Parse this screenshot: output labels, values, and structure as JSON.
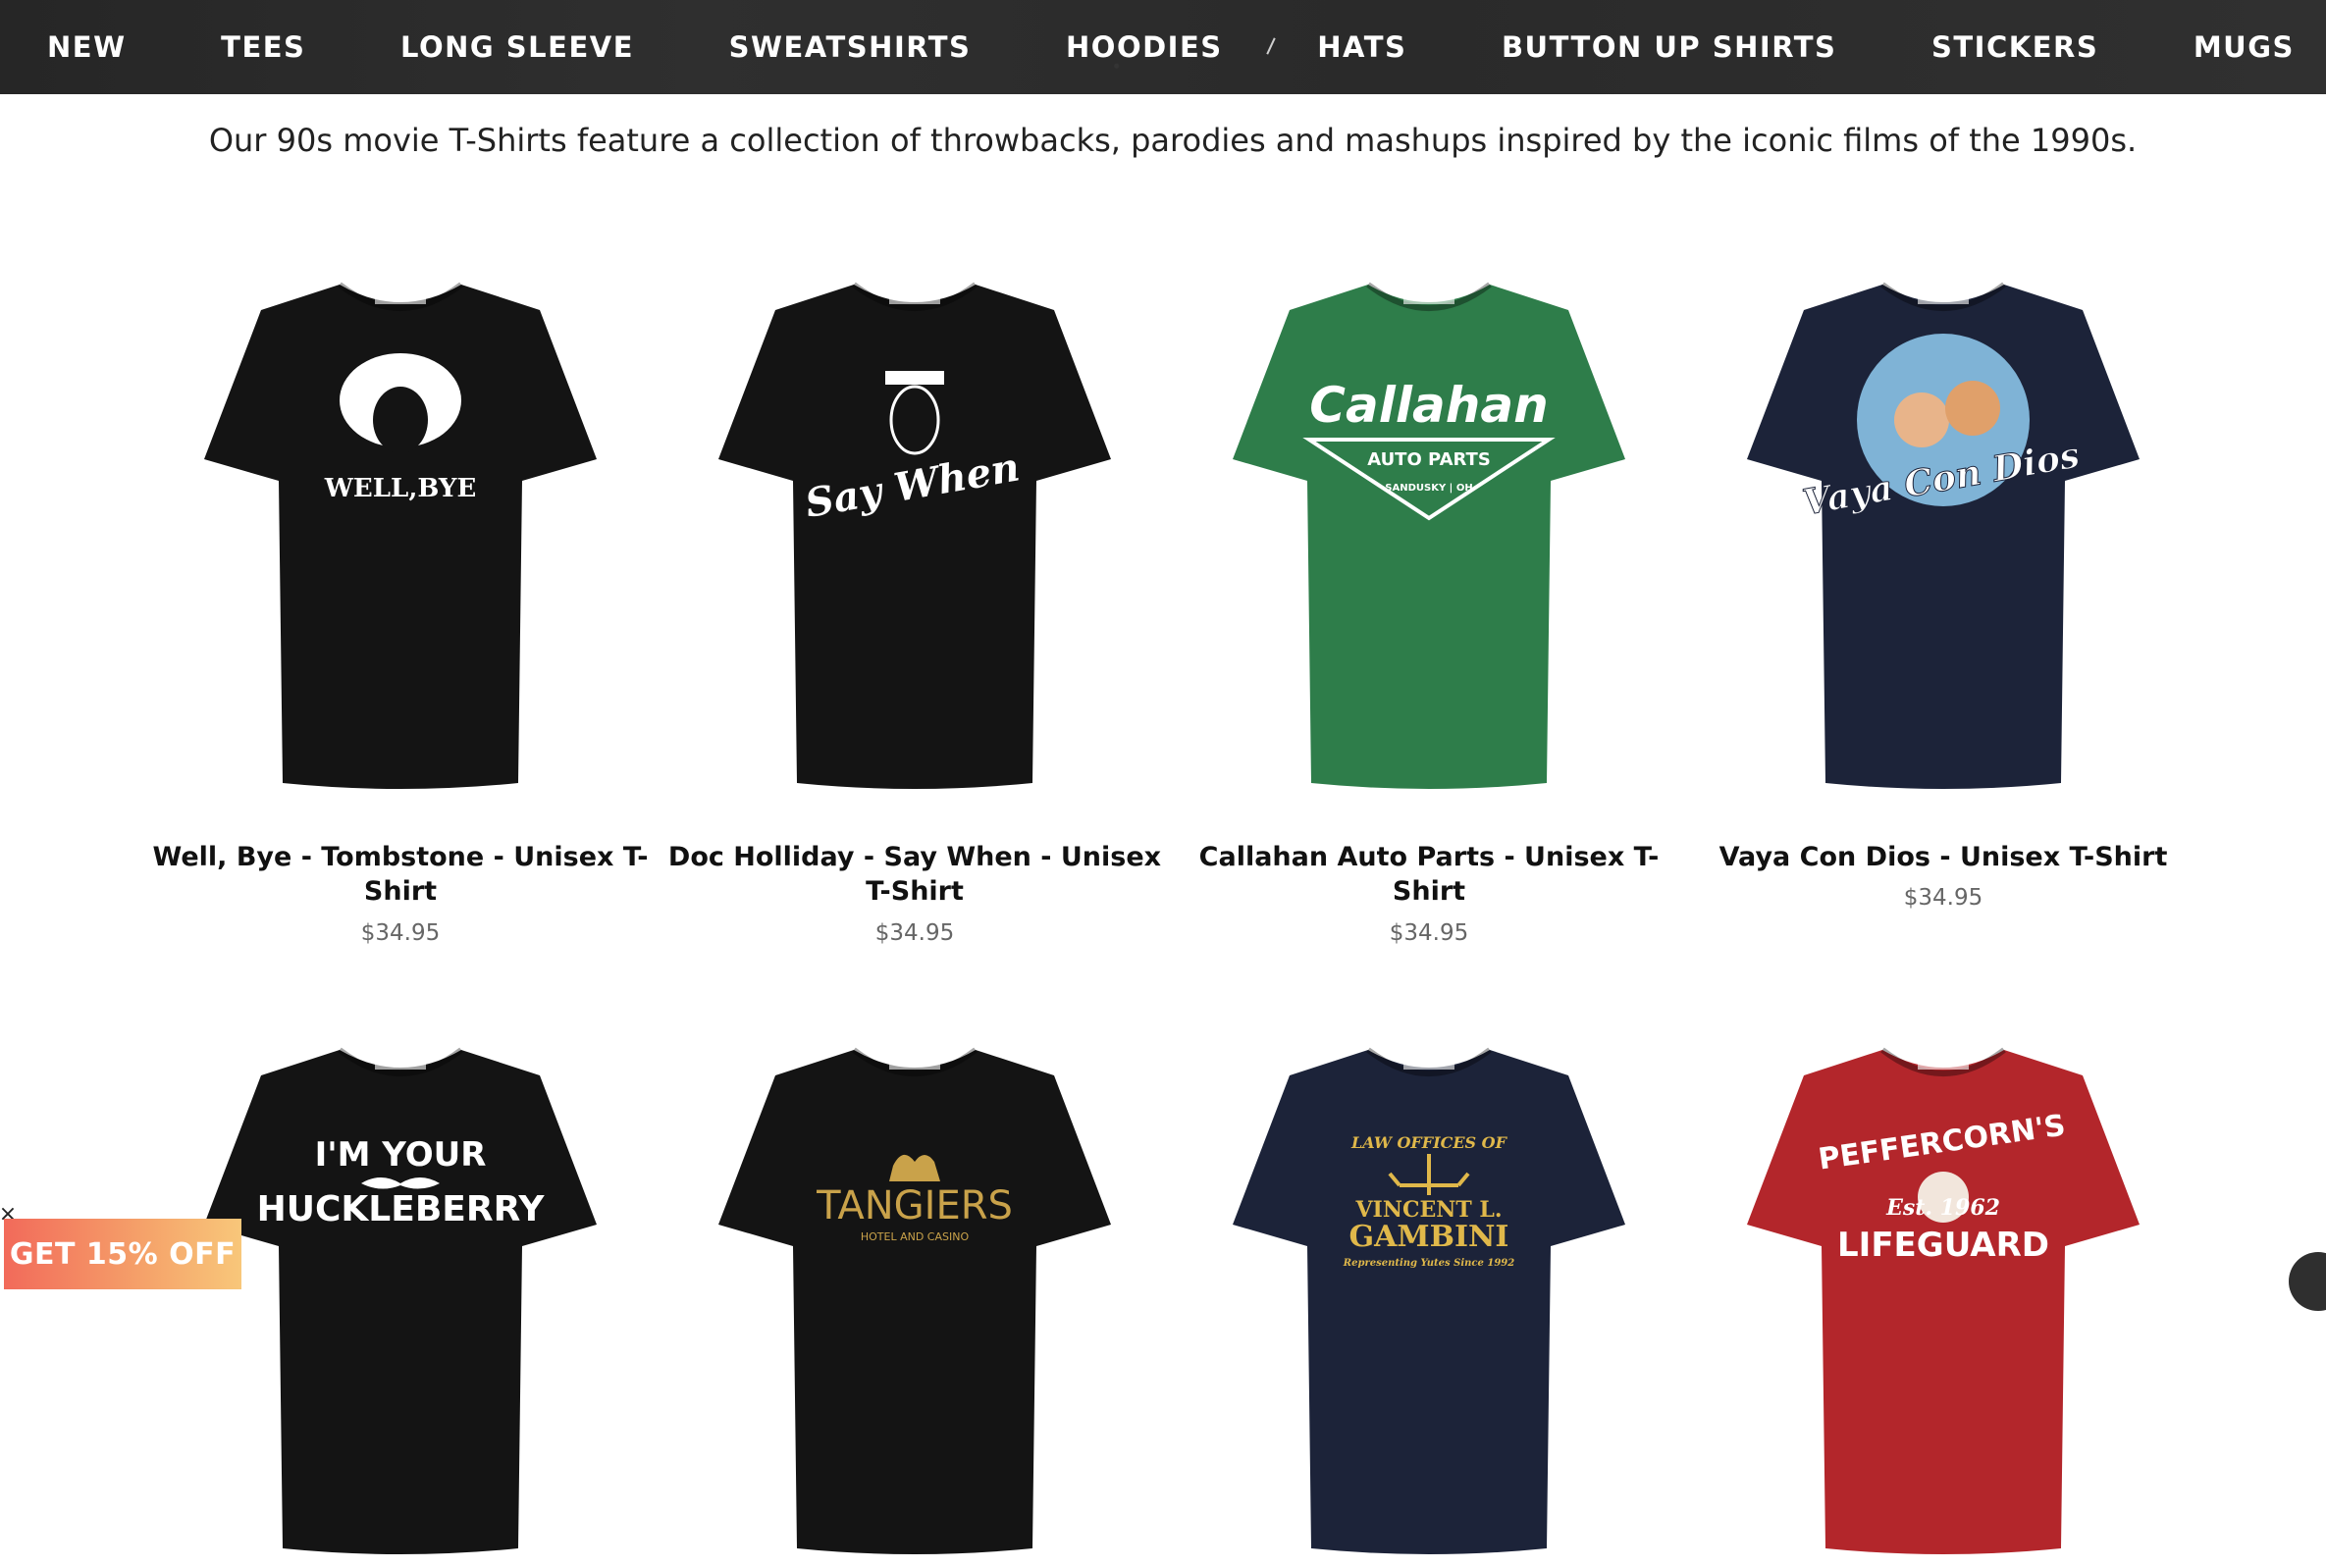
{
  "nav": {
    "items": [
      "NEW",
      "TEES",
      "LONG SLEEVE",
      "SWEATSHIRTS",
      "HOODIES",
      "HATS",
      "BUTTON UP SHIRTS",
      "STICKERS",
      "MUGS"
    ]
  },
  "intro": "Our 90s movie T-Shirts feature a collection of throwbacks, parodies and mashups inspired by the iconic films of the 1990s.",
  "products": [
    {
      "title": "Well, Bye - Tombstone - Unisex T-Shirt",
      "price": "$34.95",
      "shirt_color": "#141414",
      "print_text": "WELL,BYE",
      "print_color": "#ffffff"
    },
    {
      "title": "Doc Holliday - Say When - Unisex T-Shirt",
      "price": "$34.95",
      "shirt_color": "#141414",
      "print_text": "Say When",
      "print_color": "#ffffff"
    },
    {
      "title": "Callahan Auto Parts - Unisex T-Shirt",
      "price": "$34.95",
      "shirt_color": "#2e7d4a",
      "print_text": "Callahan",
      "print_sub": "AUTO PARTS",
      "print_sub2": "SANDUSKY | OH",
      "print_color": "#ffffff"
    },
    {
      "title": "Vaya Con Dios - Unisex T-Shirt",
      "price": "$34.95",
      "shirt_color": "#1c2339",
      "print_text": "Vaya Con Dios",
      "print_color": "#ffffff"
    },
    {
      "title": "",
      "price": "",
      "shirt_color": "#141414",
      "print_text": "I'M YOUR",
      "print_sub": "HUCKLEBERRY",
      "print_color": "#ffffff"
    },
    {
      "title": "",
      "price": "",
      "shirt_color": "#141414",
      "print_text": "TANGIERS",
      "print_sub": "HOTEL AND CASINO",
      "print_color": "#c9a24a"
    },
    {
      "title": "",
      "price": "",
      "shirt_color": "#1c2339",
      "print_text": "LAW OFFICES OF",
      "print_sub": "VINCENT L.",
      "print_sub2": "GAMBINI",
      "print_sub3": "Representing Yutes Since 1992",
      "print_color": "#e0b84a"
    },
    {
      "title": "",
      "price": "",
      "shirt_color": "#b3262b",
      "print_text": "PEFFERCORN'S",
      "print_sub": "Est. 1962",
      "print_sub2": "LIFEGUARD",
      "print_color": "#ffffff"
    }
  ],
  "discount": {
    "label": "GET 15% OFF",
    "close": "×"
  },
  "icons": {
    "close": "close-icon",
    "chat": "chat-icon"
  }
}
